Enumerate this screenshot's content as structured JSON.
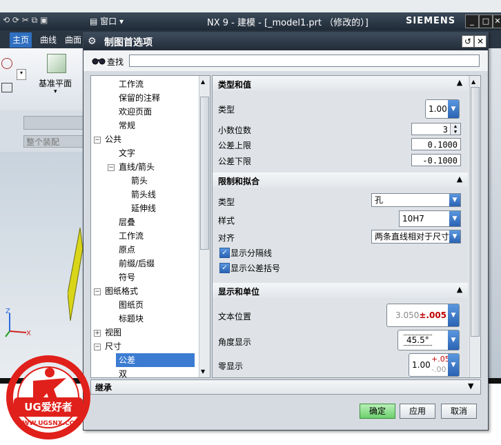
{
  "app": {
    "window_title": "NX 9 - 建模 - [_model1.prt （修改的）]",
    "brand": "SIEMENS",
    "window_menu": "窗口",
    "ribbon_tabs": [
      "主页",
      "曲线",
      "曲面"
    ],
    "ribbon_button": "基准平面",
    "assembly_field": "整个装配"
  },
  "dialog": {
    "title": "制图首选项",
    "find_label": "查找",
    "find_value": "",
    "tree": [
      {
        "label": "工作流",
        "level": 2
      },
      {
        "label": "保留的注释",
        "level": 2
      },
      {
        "label": "欢迎页面",
        "level": 2
      },
      {
        "label": "常规",
        "level": 2
      },
      {
        "label": "公共",
        "level": 1,
        "expander": "−"
      },
      {
        "label": "文字",
        "level": 2
      },
      {
        "label": "直线/箭头",
        "level": 2,
        "expander": "−"
      },
      {
        "label": "箭头",
        "level": 3
      },
      {
        "label": "箭头线",
        "level": 3
      },
      {
        "label": "延伸线",
        "level": 3
      },
      {
        "label": "层叠",
        "level": 2
      },
      {
        "label": "工作流",
        "level": 2
      },
      {
        "label": "原点",
        "level": 2
      },
      {
        "label": "前缀/后缀",
        "level": 2
      },
      {
        "label": "符号",
        "level": 2
      },
      {
        "label": "图纸格式",
        "level": 1,
        "expander": "−"
      },
      {
        "label": "图纸页",
        "level": 2
      },
      {
        "label": "标题块",
        "level": 2
      },
      {
        "label": "视图",
        "level": 1,
        "expander": "+"
      },
      {
        "label": "尺寸",
        "level": 1,
        "expander": "−"
      },
      {
        "label": "公差",
        "level": 2,
        "selected": true
      },
      {
        "label": "双",
        "level": 2
      }
    ],
    "sections": {
      "type_value": {
        "title": "类型和值",
        "type_label": "类型",
        "type_value": "1.00",
        "decimals_label": "小数位数",
        "decimals_value": "3",
        "upper_label": "公差上限",
        "upper_value": "0.1000",
        "lower_label": "公差下限",
        "lower_value": "-0.1000"
      },
      "limits_fits": {
        "title": "限制和拟合",
        "type_label": "类型",
        "type_value": "孔",
        "style_label": "样式",
        "style_value": "10H7",
        "align_label": "对齐",
        "align_value": "两条直线相对于尺寸",
        "show_separator_label": "显示分隔线",
        "show_separator_checked": true,
        "show_bracket_label": "显示公差括号",
        "show_bracket_checked": true
      },
      "display_units": {
        "title": "显示和单位",
        "text_pos_label": "文本位置",
        "text_pos_value": "3.050",
        "text_pos_tol": "±.005",
        "angle_label": "角度显示",
        "angle_value": "45.5°",
        "zero_label": "零显示",
        "zero_value": "1.00",
        "zero_upper": "+.05",
        "zero_lower": "-.00"
      }
    },
    "inherit_label": "继承",
    "buttons": {
      "ok": "确定",
      "apply": "应用",
      "cancel": "取消"
    }
  },
  "watermark": {
    "brand": "UG爱好者",
    "url": "WWW.UGSNX.COM"
  },
  "colors": {
    "accent": "#3b7cd2",
    "ok_button": "#6ccf6c",
    "tolerance_red": "#c00000"
  }
}
